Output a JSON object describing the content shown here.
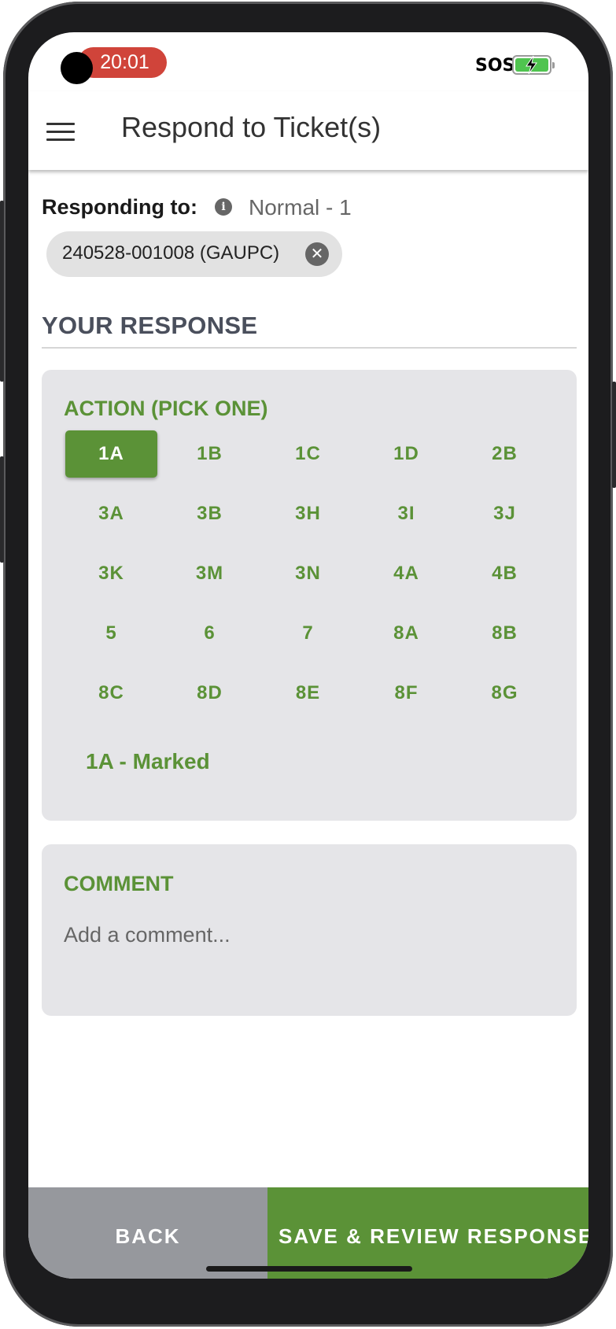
{
  "status_bar": {
    "time": "20:01",
    "sos": "SOS"
  },
  "app_bar": {
    "title": "Respond to Ticket(s)"
  },
  "responding": {
    "label": "Responding to:",
    "priority": "Normal - 1",
    "ticket_chip": "240528-001008 (GAUPC)"
  },
  "section_title": "YOUR RESPONSE",
  "action": {
    "heading": "ACTION (PICK ONE)",
    "options": [
      "1A",
      "1B",
      "1C",
      "1D",
      "2B",
      "3A",
      "3B",
      "3H",
      "3I",
      "3J",
      "3K",
      "3M",
      "3N",
      "4A",
      "4B",
      "5",
      "6",
      "7",
      "8A",
      "8B",
      "8C",
      "8D",
      "8E",
      "8F",
      "8G"
    ],
    "selected": "1A",
    "selected_description": "1A - Marked"
  },
  "comment": {
    "heading": "COMMENT",
    "placeholder": "Add a comment...",
    "value": ""
  },
  "buttons": {
    "back": "BACK",
    "save": "SAVE & REVIEW RESPONSES"
  },
  "colors": {
    "accent_green": "#5b9237",
    "card_bg": "#e5e5e8",
    "back_button": "#96989d",
    "time_pill": "#d0443a"
  },
  "icons": [
    "menu-icon",
    "info-icon",
    "close-icon",
    "battery-charging-icon"
  ]
}
